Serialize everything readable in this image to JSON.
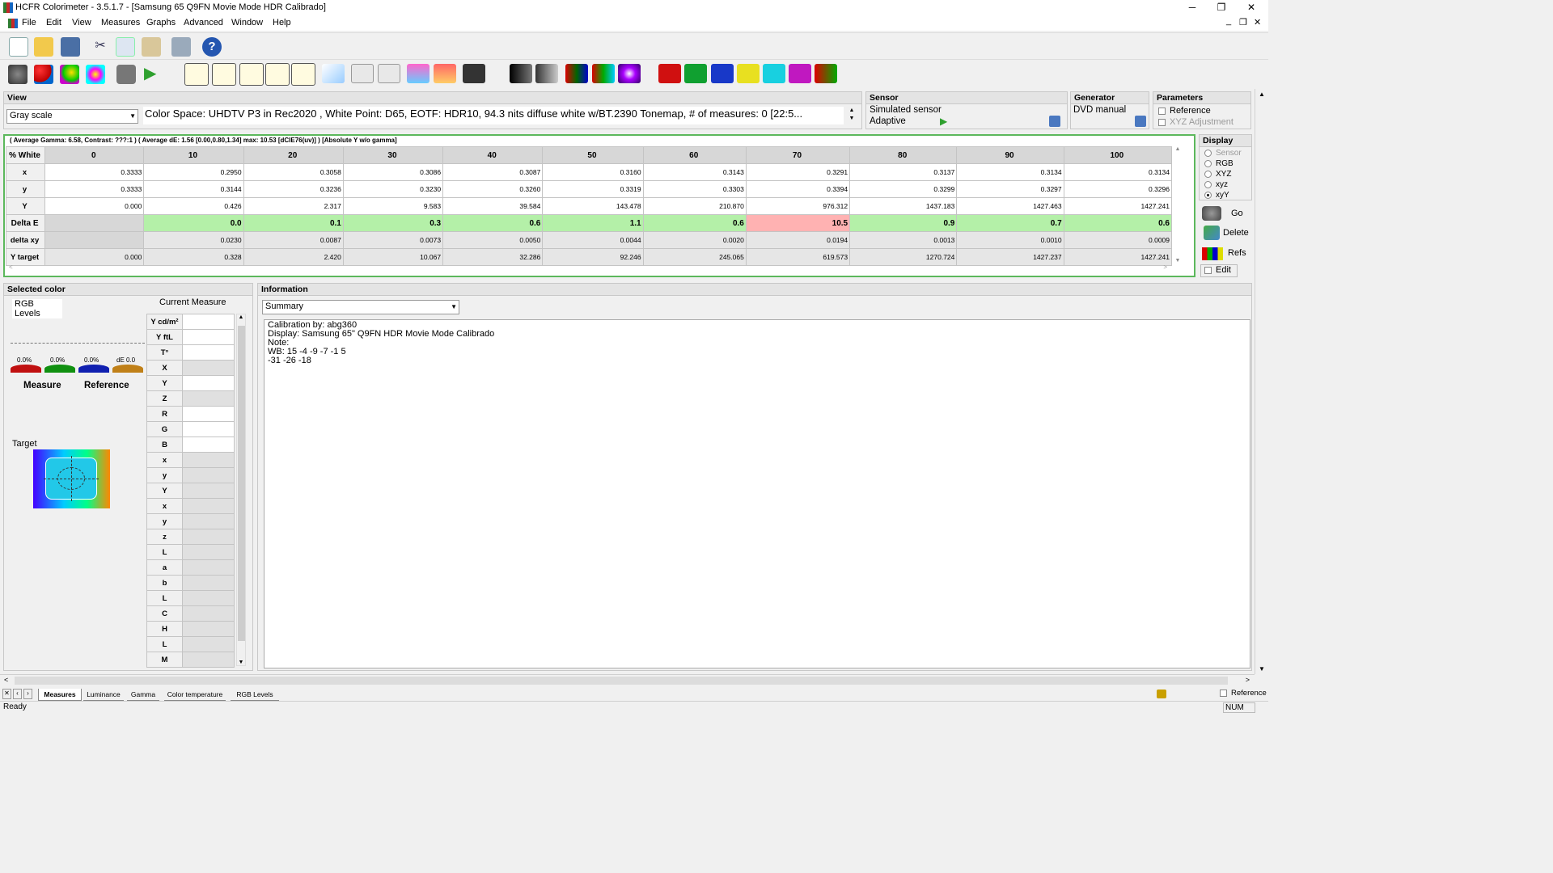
{
  "window": {
    "title": "HCFR Colorimeter - 3.5.1.7 - [Samsung 65 Q9FN Movie Mode HDR Calibrado]",
    "min": "─",
    "max": "❐",
    "close": "✕"
  },
  "menu": [
    "File",
    "Edit",
    "View",
    "Measures",
    "Graphs",
    "Advanced",
    "Window",
    "Help"
  ],
  "view": {
    "header": "View",
    "mode": "Gray scale",
    "info": "Color Space: UHDTV P3 in Rec2020 , White Point: D65, EOTF:  HDR10, 94.3 nits diffuse white w/BT.2390 Tonemap, # of measures: 0 [22:5..."
  },
  "sensor": {
    "header": "Sensor",
    "name": "Simulated sensor",
    "mode": "Adaptive"
  },
  "generator": {
    "header": "Generator",
    "name": "DVD manual"
  },
  "parameters": {
    "header": "Parameters",
    "reference": "Reference",
    "xyz_adjust": "XYZ Adjustment"
  },
  "summary_line": "( Average Gamma: 6.58, Contrast: ???:1 ) ( Average dE: 1.56 [0.00,0.80,1.34] max: 10.53 [dCIE76(uv)] ) [Absolute Y w/o gamma]",
  "grid": {
    "columns": [
      "% White",
      "0",
      "10",
      "20",
      "30",
      "40",
      "50",
      "60",
      "70",
      "80",
      "90",
      "100"
    ],
    "rows": [
      {
        "label": "x",
        "values": [
          "0.3333",
          "0.2950",
          "0.3058",
          "0.3086",
          "0.3087",
          "0.3160",
          "0.3143",
          "0.3291",
          "0.3137",
          "0.3134",
          "0.3134"
        ]
      },
      {
        "label": "y",
        "values": [
          "0.3333",
          "0.3144",
          "0.3236",
          "0.3230",
          "0.3260",
          "0.3319",
          "0.3303",
          "0.3394",
          "0.3299",
          "0.3297",
          "0.3296"
        ]
      },
      {
        "label": "Y",
        "values": [
          "0.000",
          "0.426",
          "2.317",
          "9.583",
          "39.584",
          "143.478",
          "210.870",
          "976.312",
          "1437.183",
          "1427.463",
          "1427.241"
        ]
      },
      {
        "label": "Delta E",
        "values": [
          "",
          "0.0",
          "0.1",
          "0.3",
          "0.6",
          "1.1",
          "0.6",
          "10.5",
          "0.9",
          "0.7",
          "0.6"
        ]
      },
      {
        "label": "delta xy",
        "values": [
          "",
          "0.0230",
          "0.0087",
          "0.0073",
          "0.0050",
          "0.0044",
          "0.0020",
          "0.0194",
          "0.0013",
          "0.0010",
          "0.0009"
        ]
      },
      {
        "label": "Y target",
        "values": [
          "0.000",
          "0.328",
          "2.420",
          "10.067",
          "32.286",
          "92.246",
          "245.065",
          "619.573",
          "1270.724",
          "1427.237",
          "1427.241"
        ]
      }
    ]
  },
  "display_panel": {
    "header": "Display",
    "options": [
      "Sensor",
      "RGB",
      "XYZ",
      "xyz",
      "xyY"
    ],
    "selected": "xyY",
    "go": "Go",
    "delete": "Delete",
    "refs": "Refs",
    "edit": "Edit"
  },
  "selected_color": {
    "header": "Selected color",
    "rgb_levels": "RGB Levels",
    "current_measure": "Current Measure",
    "pcts": [
      "0.0%",
      "0.0%",
      "0.0%"
    ],
    "de": "dE 0.0",
    "measure": "Measure",
    "reference": "Reference",
    "target": "Target"
  },
  "measure_labels": [
    "Y cd/m²",
    "Y ftL",
    "T°",
    "X",
    "Y",
    "Z",
    "R",
    "G",
    "B",
    "x",
    "y",
    "Y",
    "x",
    "y",
    "z",
    "L",
    "a",
    "b",
    "L",
    "C",
    "H",
    "L",
    "M"
  ],
  "information": {
    "header": "Information",
    "combo": "Summary",
    "text": "Calibration by: abg360\nDisplay: Samsung 65\" Q9FN HDR Movie Mode Calibrado\nNote:\nWB: 15 -4 -9 -7 -1 5\n-31 -26 -18"
  },
  "tabs": [
    "Measures",
    "Luminance",
    "Gamma",
    "Color temperature",
    "RGB Levels"
  ],
  "active_tab": "Measures",
  "status": {
    "left": "Ready",
    "right": "NUM",
    "reference": "Reference"
  },
  "colors": {
    "good": "#b4f0a8",
    "bad": "#ffb2b2",
    "frame": "#5cb85c"
  }
}
